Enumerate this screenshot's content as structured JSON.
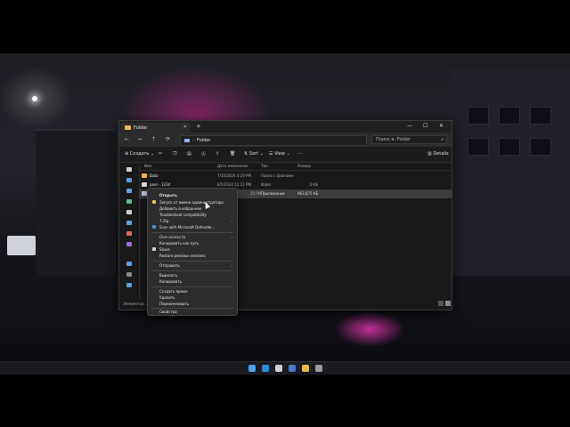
{
  "window": {
    "tab_title": "Folder",
    "tab_close": "✕",
    "new_tab": "+",
    "minimize": "—",
    "maximize": "☐",
    "close": "✕"
  },
  "nav": {
    "back": "←",
    "forward": "→",
    "up": "↑",
    "refresh": "⟳"
  },
  "address": {
    "path": "Folder",
    "separator": "›"
  },
  "search": {
    "placeholder": "Поиск в: Folder"
  },
  "toolbar": {
    "new_label": "Создать",
    "sort_label": "Sort",
    "view_label": "View",
    "more_label": "···",
    "details_label": "Details"
  },
  "columns": {
    "name": "Имя",
    "date": "Дата изменения",
    "type": "Тип",
    "size": "Размер"
  },
  "files": [
    {
      "name": "Data",
      "date": "7/10/2024 4:19 PM",
      "type": "Папка с файлами",
      "size": ""
    },
    {
      "name": "pass - 1234",
      "date": "8/5/2024 12:11 PM",
      "type": "Файл",
      "size": "0 КБ"
    },
    {
      "name": "",
      "date": "10 PM",
      "type": "Приложение",
      "size": "963,875 КБ"
    }
  ],
  "status": {
    "items_label": "Элементов: 3"
  },
  "context_menu": [
    {
      "label": "Открыть",
      "bold": true
    },
    {
      "label": "Запуск от имени администратора",
      "icon": "shield-icon"
    },
    {
      "label": "Добавить в избранное"
    },
    {
      "label": "Troubleshoot compatibility"
    },
    {
      "label": "7-Zip",
      "arrow": "›"
    },
    {
      "label": "Scan with Microsoft Defender...",
      "icon": "defender-icon"
    },
    {
      "label": "Give access to",
      "arrow": "›",
      "sep_before": true
    },
    {
      "label": "Копировать как путь"
    },
    {
      "label": "Share",
      "icon": "share-icon"
    },
    {
      "label": "Restore previous versions"
    },
    {
      "label": "Отправить",
      "arrow": "›",
      "sep_before": true
    },
    {
      "label": "Вырезать",
      "sep_before": true
    },
    {
      "label": "Копировать"
    },
    {
      "label": "Создать ярлык",
      "sep_before": true
    },
    {
      "label": "Удалить"
    },
    {
      "label": "Переименовать"
    },
    {
      "label": "Свойства",
      "sep_before": true
    }
  ],
  "colors": {
    "accent_pink": "#e0309a",
    "folder_yellow": "#e8b94a",
    "window_bg": "#191919",
    "menu_bg": "#2c2c2c"
  }
}
